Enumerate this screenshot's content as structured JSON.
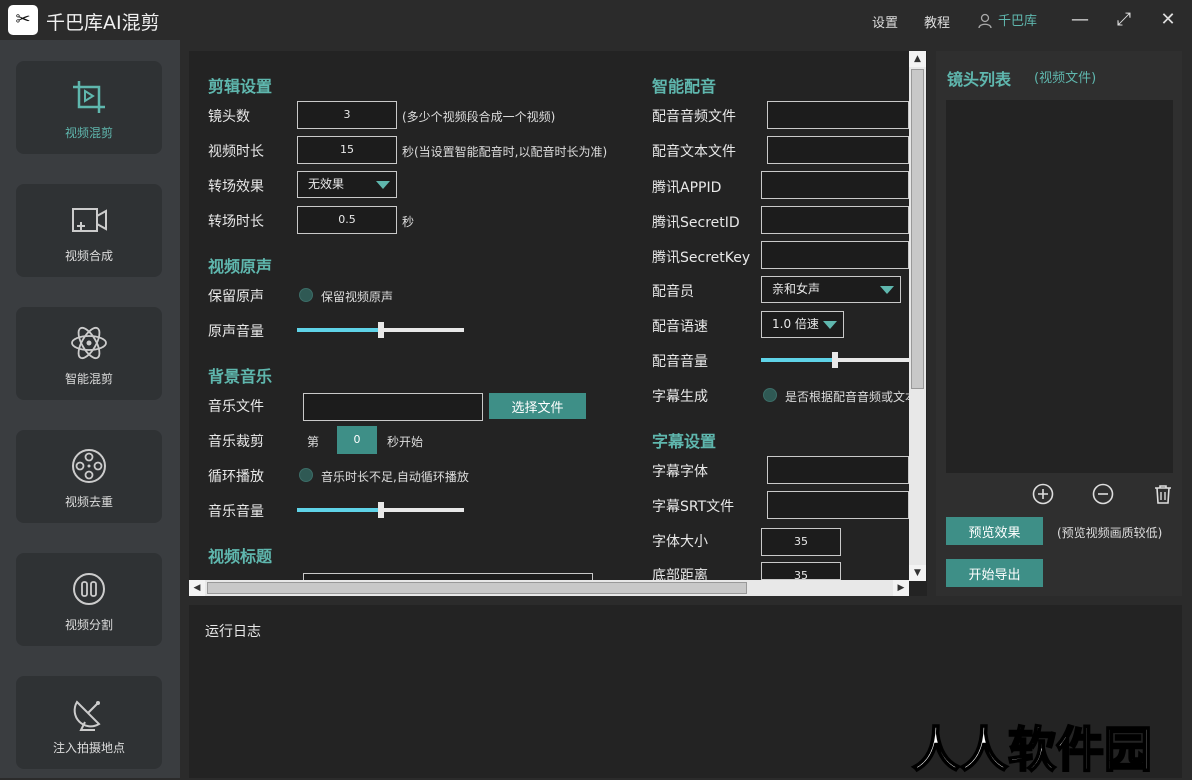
{
  "app": {
    "logo": "✂",
    "title": "千巴库AI混剪"
  },
  "titlebar": {
    "settings": "设置",
    "tutorial": "教程",
    "user": "千巴库",
    "minimize": "—",
    "maximize": "⤢",
    "close": "✕"
  },
  "sidebar": {
    "items": [
      {
        "label": "视频混剪",
        "icon": "crop-play-icon"
      },
      {
        "label": "视频合成",
        "icon": "video-add-icon"
      },
      {
        "label": "智能混剪",
        "icon": "atom-icon"
      },
      {
        "label": "视频去重",
        "icon": "film-reel-icon"
      },
      {
        "label": "视频分割",
        "icon": "split-icon"
      },
      {
        "label": "注入拍摄地点",
        "icon": "satellite-dish-icon"
      }
    ]
  },
  "edit": {
    "title": "剪辑设置",
    "lens_count_label": "镜头数",
    "lens_count": "3",
    "lens_count_hint": "(多少个视频段合成一个视频)",
    "duration_label": "视频时长",
    "duration": "15",
    "duration_hint": "秒(当设置智能配音时,以配音时长为准)",
    "transition_label": "转场效果",
    "transition": "无效果",
    "transition_time_label": "转场时长",
    "transition_time": "0.5",
    "transition_time_unit": "秒"
  },
  "original_audio": {
    "title": "视频原声",
    "keep_label": "保留原声",
    "keep_option": "保留视频原声",
    "volume_label": "原声音量",
    "volume": 0.5
  },
  "bgm": {
    "title": "背景音乐",
    "file_label": "音乐文件",
    "file_value": "",
    "choose_button": "选择文件",
    "trim_label": "音乐裁剪",
    "trim_prefix": "第",
    "trim_value": "0",
    "trim_suffix": "秒开始",
    "loop_label": "循环播放",
    "loop_option": "音乐时长不足,自动循环播放",
    "volume_label": "音乐音量",
    "volume": 0.5
  },
  "video_title": {
    "title": "视频标题"
  },
  "dubbing": {
    "title": "智能配音",
    "audio_file_label": "配音音频文件",
    "text_file_label": "配音文本文件",
    "appid_label": "腾讯APPID",
    "secretid_label": "腾讯SecretID",
    "secretkey_label": "腾讯SecretKey",
    "voice_label": "配音员",
    "voice": "亲和女声",
    "speed_label": "配音语速",
    "speed": "1.0 倍速",
    "volume_label": "配音音量",
    "volume": 0.5,
    "subtitle_gen_label": "字幕生成",
    "subtitle_gen_option": "是否根据配音音频或文本"
  },
  "subtitle": {
    "title": "字幕设置",
    "font_label": "字幕字体",
    "srt_label": "字幕SRT文件",
    "size_label": "字体大小",
    "size": "35",
    "bottom_label": "底部距离",
    "bottom": "35"
  },
  "lens_list": {
    "title": "镜头列表",
    "subtitle": "(视频文件)",
    "preview_button": "预览效果",
    "preview_hint": "(预览视频画质较低)",
    "export_button": "开始导出"
  },
  "log": {
    "title": "运行日志"
  },
  "watermark": "人人软件园",
  "colors": {
    "accent": "#5fb7ae",
    "button": "#3e8f87",
    "slider": "#5fd3e8"
  }
}
